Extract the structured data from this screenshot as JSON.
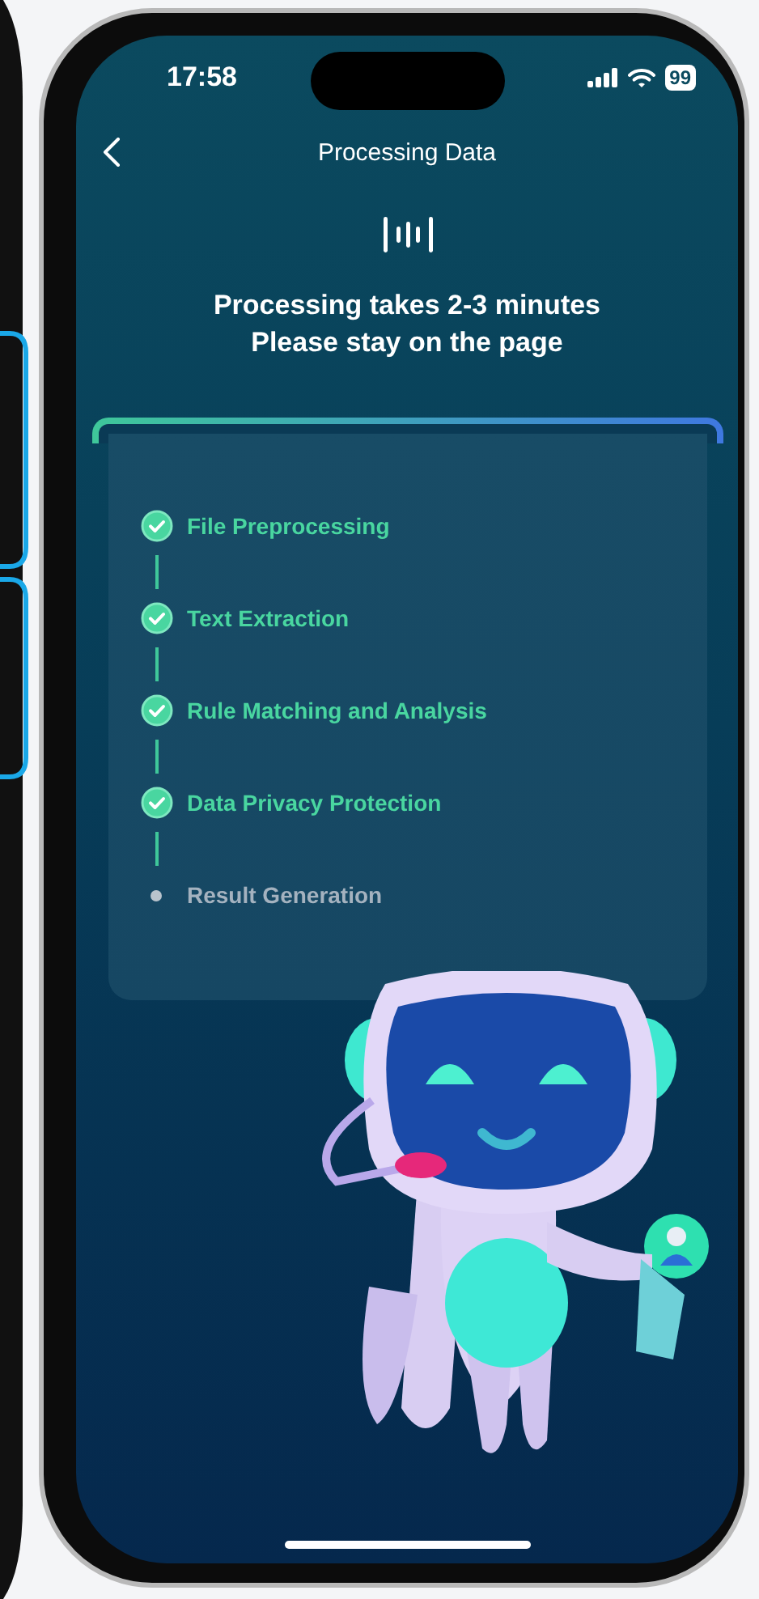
{
  "status_bar": {
    "time": "17:58",
    "battery": "99"
  },
  "header": {
    "title": "Processing Data"
  },
  "notice": {
    "lines": [
      "Processing takes 2-3 minutes",
      "Please stay on the page"
    ]
  },
  "steps": [
    {
      "label": "File Preprocessing",
      "done": true
    },
    {
      "label": "Text Extraction",
      "done": true
    },
    {
      "label": "Rule Matching and Analysis",
      "done": true
    },
    {
      "label": "Data Privacy Protection",
      "done": true
    },
    {
      "label": "Result Generation",
      "done": false
    }
  ]
}
